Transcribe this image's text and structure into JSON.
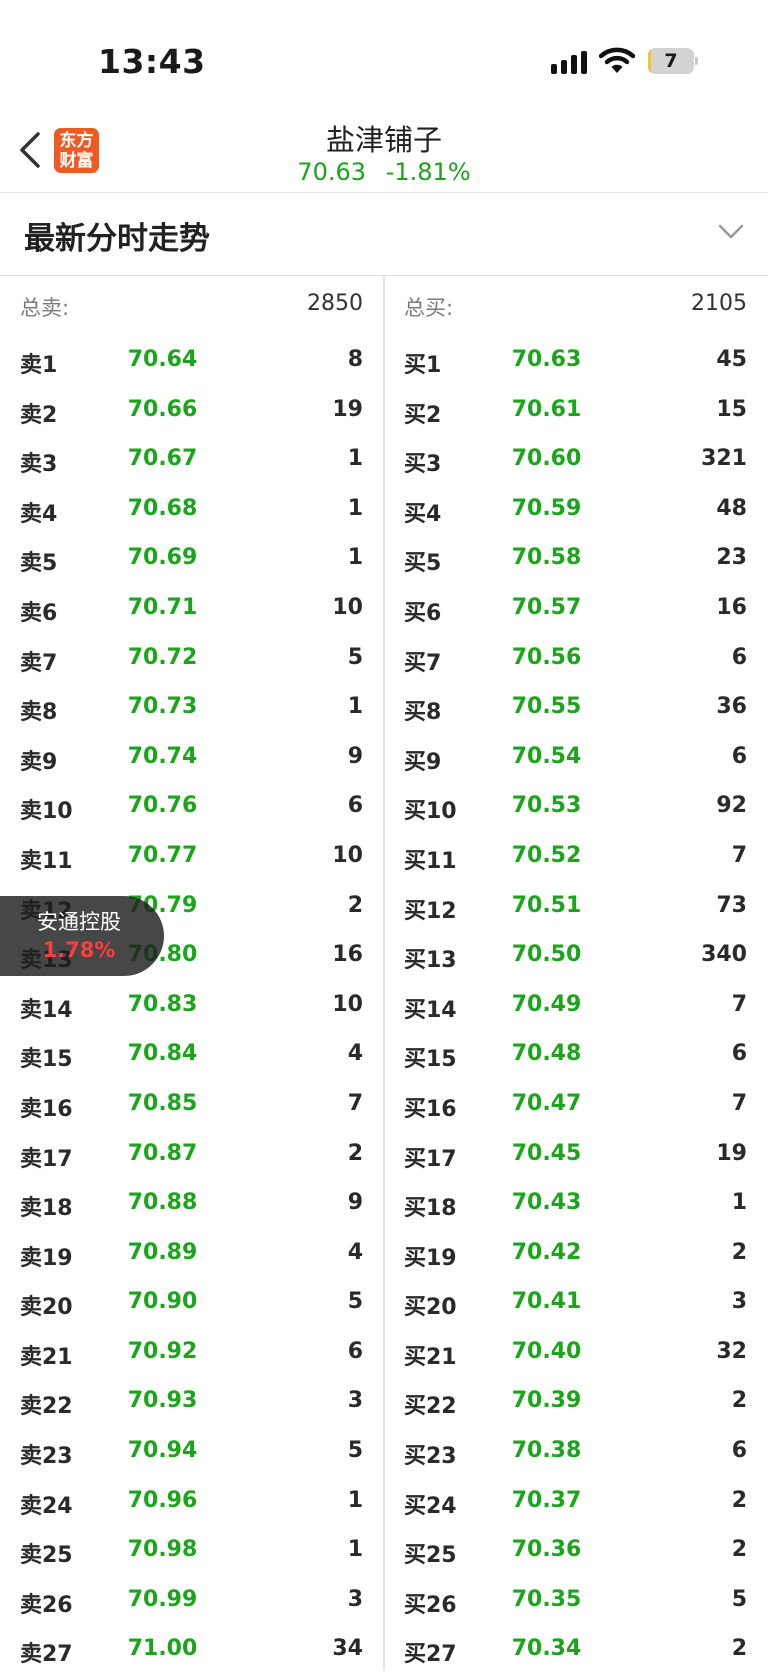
{
  "status_bar": {
    "time": "13:43",
    "battery": "7",
    "battery_level": 0.07
  },
  "header": {
    "logo": [
      "东方",
      "财富"
    ],
    "name": "盐津铺子",
    "price": "70.63",
    "change": "-1.81%"
  },
  "section": {
    "title": "最新分时走势"
  },
  "book": {
    "sell_total_label": "总卖:",
    "sell_total": "2850",
    "buy_total_label": "总买:",
    "buy_total": "2105",
    "sell": [
      {
        "level": "卖1",
        "price": "70.64",
        "volume": "8"
      },
      {
        "level": "卖2",
        "price": "70.66",
        "volume": "19"
      },
      {
        "level": "卖3",
        "price": "70.67",
        "volume": "1"
      },
      {
        "level": "卖4",
        "price": "70.68",
        "volume": "1"
      },
      {
        "level": "卖5",
        "price": "70.69",
        "volume": "1"
      },
      {
        "level": "卖6",
        "price": "70.71",
        "volume": "10"
      },
      {
        "level": "卖7",
        "price": "70.72",
        "volume": "5"
      },
      {
        "level": "卖8",
        "price": "70.73",
        "volume": "1"
      },
      {
        "level": "卖9",
        "price": "70.74",
        "volume": "9"
      },
      {
        "level": "卖10",
        "price": "70.76",
        "volume": "6"
      },
      {
        "level": "卖11",
        "price": "70.77",
        "volume": "10"
      },
      {
        "level": "卖12",
        "price": "70.79",
        "volume": "2"
      },
      {
        "level": "卖13",
        "price": "70.80",
        "volume": "16"
      },
      {
        "level": "卖14",
        "price": "70.83",
        "volume": "10"
      },
      {
        "level": "卖15",
        "price": "70.84",
        "volume": "4"
      },
      {
        "level": "卖16",
        "price": "70.85",
        "volume": "7"
      },
      {
        "level": "卖17",
        "price": "70.87",
        "volume": "2"
      },
      {
        "level": "卖18",
        "price": "70.88",
        "volume": "9"
      },
      {
        "level": "卖19",
        "price": "70.89",
        "volume": "4"
      },
      {
        "level": "卖20",
        "price": "70.90",
        "volume": "5"
      },
      {
        "level": "卖21",
        "price": "70.92",
        "volume": "6"
      },
      {
        "level": "卖22",
        "price": "70.93",
        "volume": "3"
      },
      {
        "level": "卖23",
        "price": "70.94",
        "volume": "5"
      },
      {
        "level": "卖24",
        "price": "70.96",
        "volume": "1"
      },
      {
        "level": "卖25",
        "price": "70.98",
        "volume": "1"
      },
      {
        "level": "卖26",
        "price": "70.99",
        "volume": "3"
      },
      {
        "level": "卖27",
        "price": "71.00",
        "volume": "34"
      }
    ],
    "buy": [
      {
        "level": "买1",
        "price": "70.63",
        "volume": "45"
      },
      {
        "level": "买2",
        "price": "70.61",
        "volume": "15"
      },
      {
        "level": "买3",
        "price": "70.60",
        "volume": "321"
      },
      {
        "level": "买4",
        "price": "70.59",
        "volume": "48"
      },
      {
        "level": "买5",
        "price": "70.58",
        "volume": "23"
      },
      {
        "level": "买6",
        "price": "70.57",
        "volume": "16"
      },
      {
        "level": "买7",
        "price": "70.56",
        "volume": "6"
      },
      {
        "level": "买8",
        "price": "70.55",
        "volume": "36"
      },
      {
        "level": "买9",
        "price": "70.54",
        "volume": "6"
      },
      {
        "level": "买10",
        "price": "70.53",
        "volume": "92"
      },
      {
        "level": "买11",
        "price": "70.52",
        "volume": "7"
      },
      {
        "level": "买12",
        "price": "70.51",
        "volume": "73"
      },
      {
        "level": "买13",
        "price": "70.50",
        "volume": "340"
      },
      {
        "level": "买14",
        "price": "70.49",
        "volume": "7"
      },
      {
        "level": "买15",
        "price": "70.48",
        "volume": "6"
      },
      {
        "level": "买16",
        "price": "70.47",
        "volume": "7"
      },
      {
        "level": "买17",
        "price": "70.45",
        "volume": "19"
      },
      {
        "level": "买18",
        "price": "70.43",
        "volume": "1"
      },
      {
        "level": "买19",
        "price": "70.42",
        "volume": "2"
      },
      {
        "level": "买20",
        "price": "70.41",
        "volume": "3"
      },
      {
        "level": "买21",
        "price": "70.40",
        "volume": "32"
      },
      {
        "level": "买22",
        "price": "70.39",
        "volume": "2"
      },
      {
        "level": "买23",
        "price": "70.38",
        "volume": "6"
      },
      {
        "level": "买24",
        "price": "70.37",
        "volume": "2"
      },
      {
        "level": "买25",
        "price": "70.36",
        "volume": "2"
      },
      {
        "level": "买26",
        "price": "70.35",
        "volume": "5"
      },
      {
        "level": "买27",
        "price": "70.34",
        "volume": "2"
      }
    ]
  },
  "floating_tag": {
    "name": "安通控股",
    "change": "1.78%"
  },
  "colors": {
    "down": "#1ba51b",
    "up": "#ff3b3b",
    "logo": "#ee5a24",
    "battery": "#f5c623"
  },
  "icons": [
    "back-chevron-icon",
    "chevron-down-icon",
    "signal-icon",
    "wifi-icon",
    "battery-icon"
  ]
}
